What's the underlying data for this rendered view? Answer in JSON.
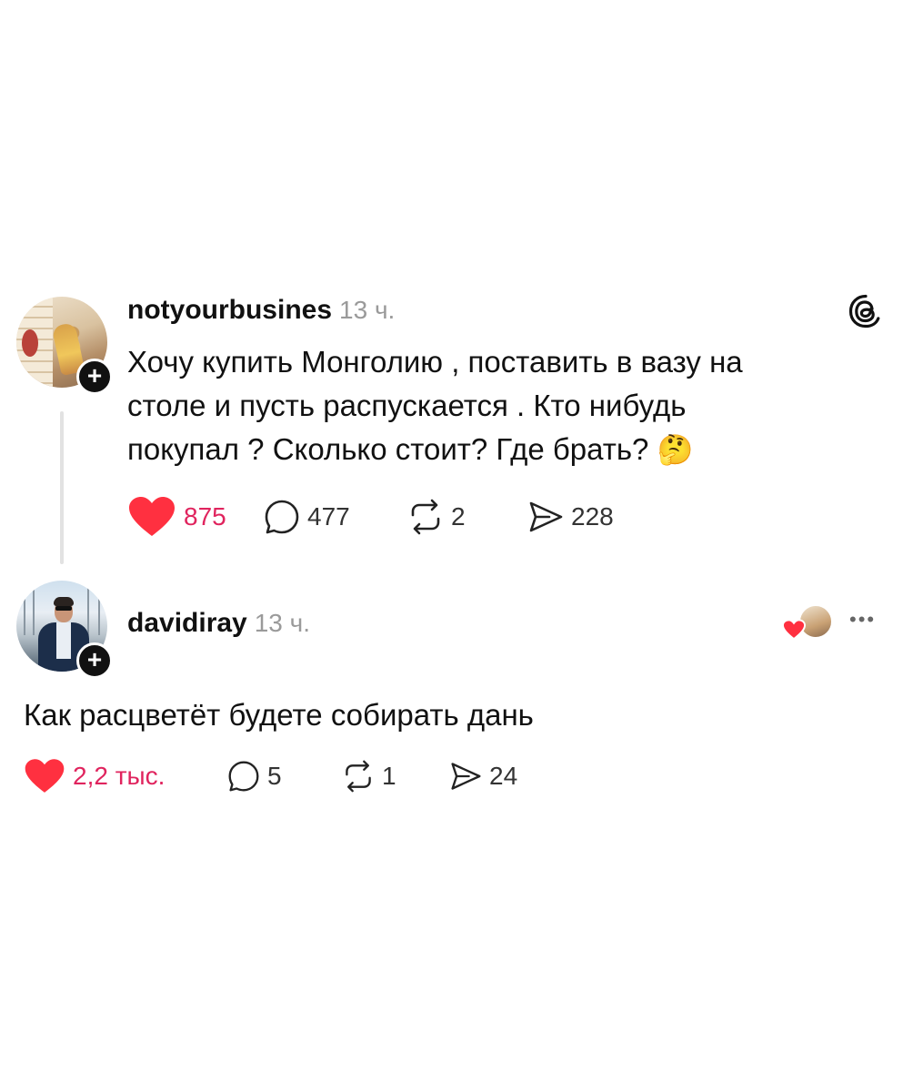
{
  "post": {
    "username": "notyourbusines",
    "time": "13 ч.",
    "text_lines": [
      "Хочу купить Монголию , поставить в вазу на",
      "столе и пусть распускается . Кто нибудь",
      "покупал ? Сколько стоит? Где брать?"
    ],
    "emoji": "🤔",
    "likes": "875",
    "comments": "477",
    "reposts": "2",
    "shares": "228"
  },
  "reply": {
    "username": "davidiray",
    "time": "13 ч.",
    "text": "Как расцветёт будете собирать дань",
    "likes": "2,2 тыс.",
    "comments": "5",
    "reposts": "1",
    "shares": "24",
    "more": "•••"
  },
  "icons": {
    "threads": "threads-logo-icon",
    "heart": "heart-icon",
    "comment": "comment-icon",
    "repost": "repost-icon",
    "share": "share-icon",
    "follow": "plus-icon",
    "more": "more-icon"
  },
  "colors": {
    "like": "#e0245e",
    "heart_fill": "#ff3040",
    "muted": "#9a9a9a",
    "text": "#111111"
  }
}
